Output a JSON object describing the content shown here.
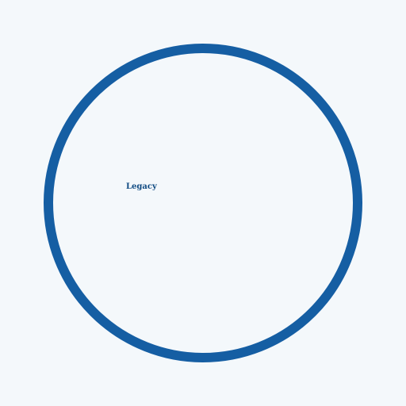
{
  "label": "Legacy",
  "colors": {
    "background": "#f4f8fb",
    "ring": "#155ea3",
    "label": "#0f4a82"
  }
}
